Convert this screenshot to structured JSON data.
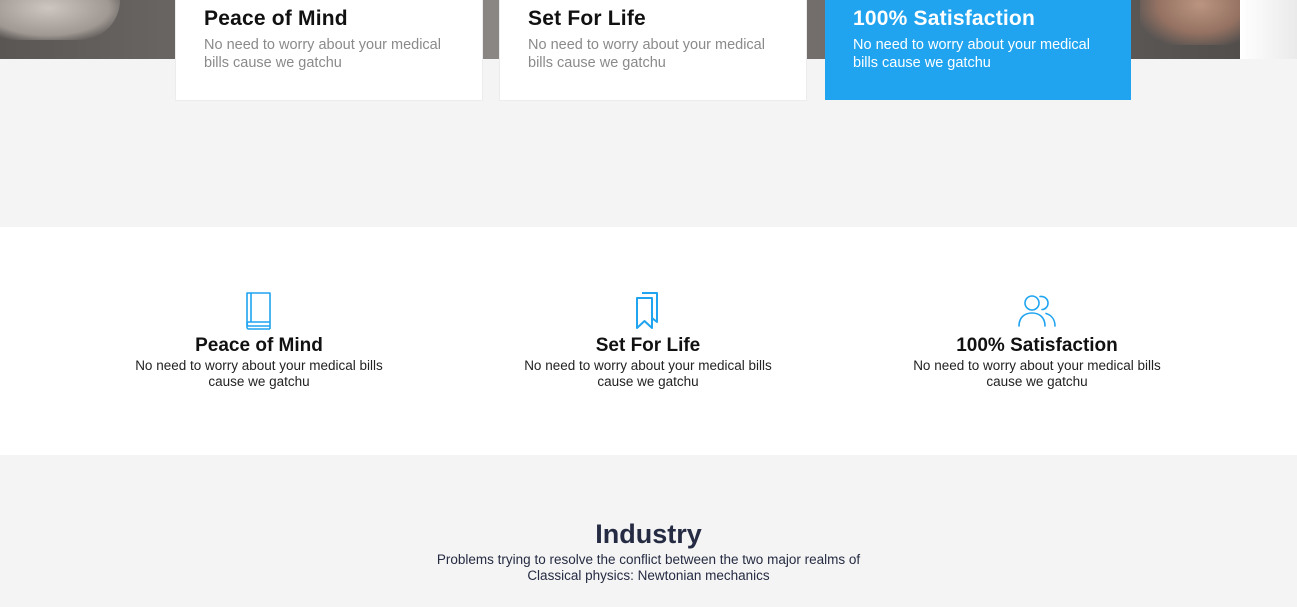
{
  "top_cards": [
    {
      "title": "Peace of Mind",
      "text": "No need to worry about your medical bills cause we gatchu"
    },
    {
      "title": "Set For Life",
      "text": "No need to worry about your medical bills cause we gatchu"
    },
    {
      "title": "100% Satisfaction",
      "text": "No need to worry about your medical bills cause we gatchu"
    }
  ],
  "features": [
    {
      "icon": "book-icon",
      "title": "Peace of Mind",
      "text": "No need to worry about your medical bills cause we gatchu"
    },
    {
      "icon": "bookmarks-icon",
      "title": "Set For Life",
      "text": "No need to worry about your medical bills cause we gatchu"
    },
    {
      "icon": "users-icon",
      "title": "100% Satisfaction",
      "text": "No need to worry about your medical bills cause we gatchu"
    }
  ],
  "industry": {
    "title": "Industry",
    "text": "Problems trying to resolve the conflict between the two major realms of Classical physics: Newtonian mechanics"
  },
  "colors": {
    "accent": "#20a4f0",
    "heading": "#252b42"
  }
}
